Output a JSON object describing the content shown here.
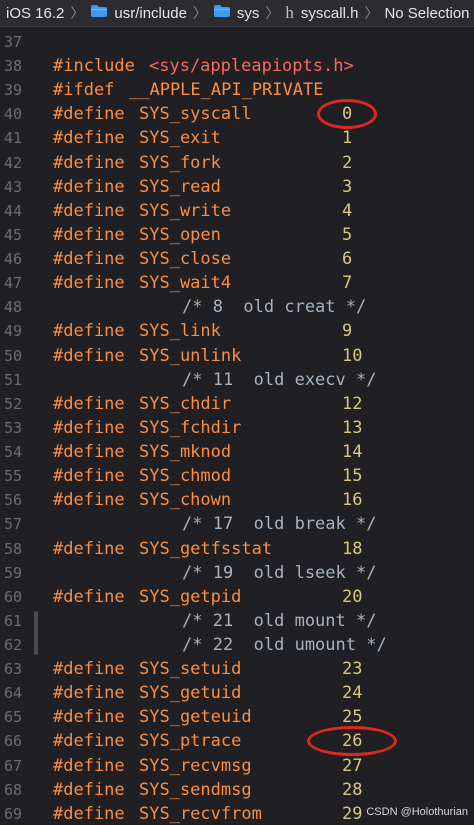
{
  "breadcrumb": {
    "items": [
      "iOS 16.2",
      "usr/include",
      "sys",
      "syscall.h",
      "No Selection"
    ],
    "icons": [
      "",
      "folder-icon",
      "folder-icon",
      "header-file-icon",
      ""
    ]
  },
  "colors": {
    "background": "#1f1f24",
    "keyword": "#fd8f3f",
    "include_path": "#fc6a5d",
    "number": "#d9c97c",
    "comment": "#a7b3c0",
    "line_number": "#6c6c72",
    "highlight_ring": "#e0291c"
  },
  "lines": [
    {
      "n": "37"
    },
    {
      "n": "38",
      "kw": "#include",
      "inc": "<sys/appleapiopts.h>"
    },
    {
      "n": "39",
      "kw": "#ifdef",
      "mac": "__APPLE_API_PRIVATE"
    },
    {
      "n": "40",
      "kw": "#define",
      "mac": "SYS_syscall",
      "num": "0"
    },
    {
      "n": "41",
      "kw": "#define",
      "mac": "SYS_exit",
      "num": "1"
    },
    {
      "n": "42",
      "kw": "#define",
      "mac": "SYS_fork",
      "num": "2"
    },
    {
      "n": "43",
      "kw": "#define",
      "mac": "SYS_read",
      "num": "3"
    },
    {
      "n": "44",
      "kw": "#define",
      "mac": "SYS_write",
      "num": "4"
    },
    {
      "n": "45",
      "kw": "#define",
      "mac": "SYS_open",
      "num": "5"
    },
    {
      "n": "46",
      "kw": "#define",
      "mac": "SYS_close",
      "num": "6"
    },
    {
      "n": "47",
      "kw": "#define",
      "mac": "SYS_wait4",
      "num": "7"
    },
    {
      "n": "48",
      "cmt": "/* 8  old creat */"
    },
    {
      "n": "49",
      "kw": "#define",
      "mac": "SYS_link",
      "num": "9"
    },
    {
      "n": "50",
      "kw": "#define",
      "mac": "SYS_unlink",
      "num": "10"
    },
    {
      "n": "51",
      "cmt": "/* 11  old execv */"
    },
    {
      "n": "52",
      "kw": "#define",
      "mac": "SYS_chdir",
      "num": "12"
    },
    {
      "n": "53",
      "kw": "#define",
      "mac": "SYS_fchdir",
      "num": "13"
    },
    {
      "n": "54",
      "kw": "#define",
      "mac": "SYS_mknod",
      "num": "14"
    },
    {
      "n": "55",
      "kw": "#define",
      "mac": "SYS_chmod",
      "num": "15"
    },
    {
      "n": "56",
      "kw": "#define",
      "mac": "SYS_chown",
      "num": "16"
    },
    {
      "n": "57",
      "cmt": "/* 17  old break */"
    },
    {
      "n": "58",
      "kw": "#define",
      "mac": "SYS_getfsstat",
      "num": "18"
    },
    {
      "n": "59",
      "cmt": "/* 19  old lseek */"
    },
    {
      "n": "60",
      "kw": "#define",
      "mac": "SYS_getpid",
      "num": "20"
    },
    {
      "n": "61",
      "cmt": "/* 21  old mount */"
    },
    {
      "n": "62",
      "cmt": "/* 22  old umount */"
    },
    {
      "n": "63",
      "kw": "#define",
      "mac": "SYS_setuid",
      "num": "23"
    },
    {
      "n": "64",
      "kw": "#define",
      "mac": "SYS_getuid",
      "num": "24"
    },
    {
      "n": "65",
      "kw": "#define",
      "mac": "SYS_geteuid",
      "num": "25"
    },
    {
      "n": "66",
      "kw": "#define",
      "mac": "SYS_ptrace",
      "num": "26"
    },
    {
      "n": "67",
      "kw": "#define",
      "mac": "SYS_recvmsg",
      "num": "27"
    },
    {
      "n": "68",
      "kw": "#define",
      "mac": "SYS_sendmsg",
      "num": "28"
    },
    {
      "n": "69",
      "kw": "#define",
      "mac": "SYS_recvfrom",
      "num": "29"
    }
  ],
  "highlights": [
    "0",
    "26"
  ],
  "watermark": "CSDN @Holothurian"
}
